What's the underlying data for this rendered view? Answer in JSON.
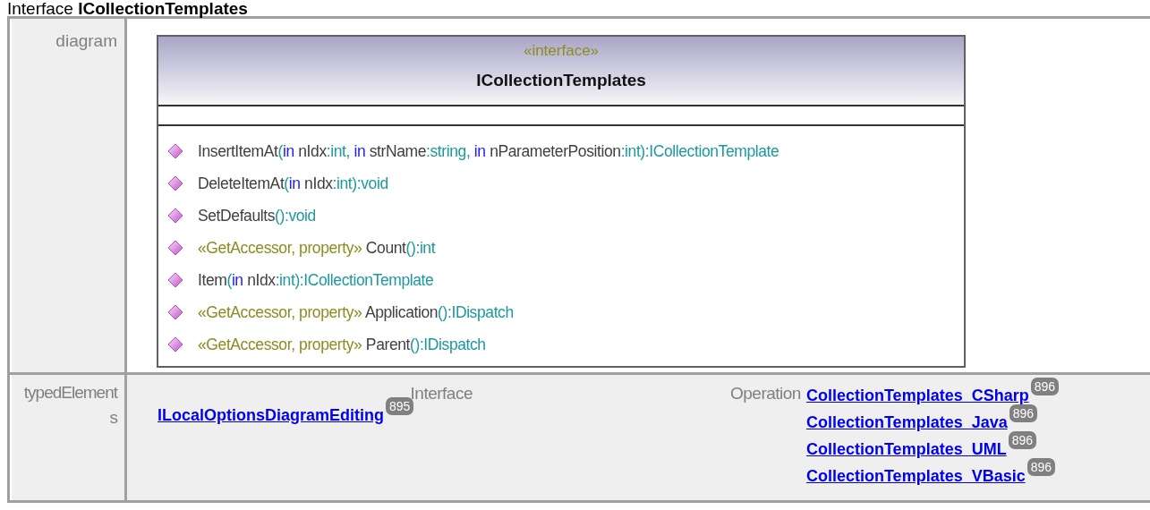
{
  "heading": {
    "prefix": "Interface",
    "name": "ICollectionTemplates"
  },
  "diagram_row": {
    "label": "diagram",
    "class_box": {
      "stereotype": "«interface»",
      "name": "ICollectionTemplates",
      "operations": [
        {
          "parts": [
            {
              "kind": "name",
              "text": "InsertItemAt"
            },
            {
              "kind": "type",
              "text": "("
            },
            {
              "kind": "keyword",
              "text": "in"
            },
            {
              "kind": "name",
              "text": " nIdx"
            },
            {
              "kind": "type",
              "text": ":int, "
            },
            {
              "kind": "keyword",
              "text": "in"
            },
            {
              "kind": "name",
              "text": " strName"
            },
            {
              "kind": "type",
              "text": ":string, "
            },
            {
              "kind": "keyword",
              "text": "in"
            },
            {
              "kind": "name",
              "text": " nParameterPosition"
            },
            {
              "kind": "type",
              "text": ":int):ICollectionTemplate"
            }
          ]
        },
        {
          "parts": [
            {
              "kind": "name",
              "text": "DeleteItemAt"
            },
            {
              "kind": "type",
              "text": "("
            },
            {
              "kind": "keyword",
              "text": "in"
            },
            {
              "kind": "name",
              "text": " nIdx"
            },
            {
              "kind": "type",
              "text": ":int):void"
            }
          ]
        },
        {
          "parts": [
            {
              "kind": "name",
              "text": "SetDefaults"
            },
            {
              "kind": "type",
              "text": "():void"
            }
          ]
        },
        {
          "parts": [
            {
              "kind": "stereotype",
              "text": "«GetAccessor, property» "
            },
            {
              "kind": "name",
              "text": "Count"
            },
            {
              "kind": "type",
              "text": "():int"
            }
          ]
        },
        {
          "parts": [
            {
              "kind": "name",
              "text": "Item"
            },
            {
              "kind": "type",
              "text": "("
            },
            {
              "kind": "keyword",
              "text": "in"
            },
            {
              "kind": "name",
              "text": " nIdx"
            },
            {
              "kind": "type",
              "text": ":int):ICollectionTemplate"
            }
          ]
        },
        {
          "parts": [
            {
              "kind": "stereotype",
              "text": "«GetAccessor, property» "
            },
            {
              "kind": "name",
              "text": "Application"
            },
            {
              "kind": "type",
              "text": "():IDispatch"
            }
          ]
        },
        {
          "parts": [
            {
              "kind": "stereotype",
              "text": "«GetAccessor, property» "
            },
            {
              "kind": "name",
              "text": "Parent"
            },
            {
              "kind": "type",
              "text": "():IDispatch"
            }
          ]
        }
      ]
    }
  },
  "typed_elements_row": {
    "label": "typedElements",
    "interface_column": {
      "header": "Interface",
      "links": [
        {
          "text": "ILocalOptionsDiagramEditing",
          "badge": "895"
        }
      ]
    },
    "operation_column": {
      "header": "Operation",
      "links": [
        {
          "text": "CollectionTemplates_CSharp",
          "badge": "896"
        },
        {
          "text": "CollectionTemplates_Java",
          "badge": "896"
        },
        {
          "text": "CollectionTemplates_UML",
          "badge": "896"
        },
        {
          "text": "CollectionTemplates_VBasic",
          "badge": "896"
        }
      ]
    }
  }
}
